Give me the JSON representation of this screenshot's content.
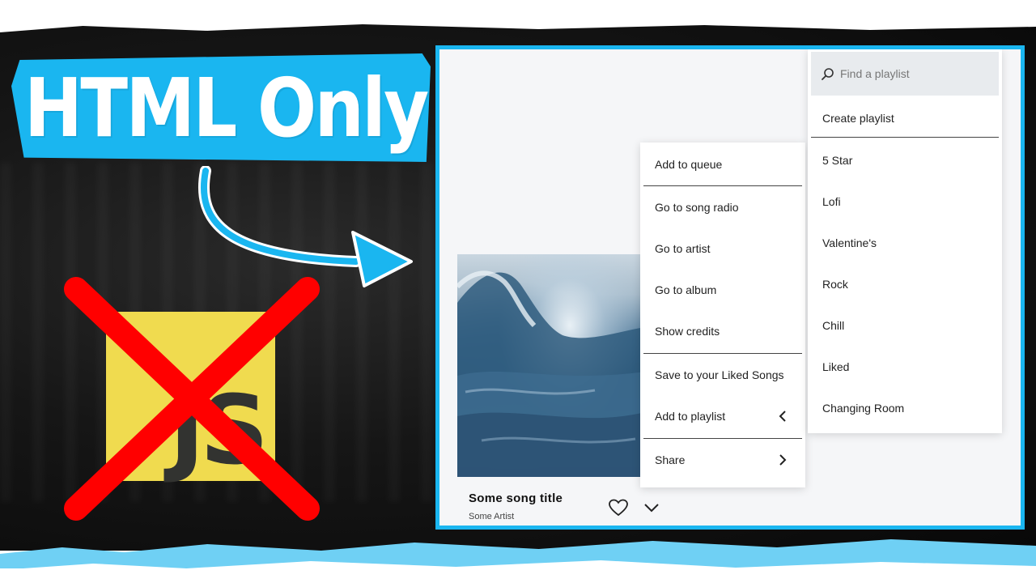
{
  "headline": {
    "text": "HTML Only"
  },
  "js_logo": {
    "text": "JS"
  },
  "song": {
    "title": "Some song title",
    "artist": "Some Artist"
  },
  "context_menu": {
    "items": [
      {
        "label": "Add to queue"
      },
      {
        "label": "Go to song radio"
      },
      {
        "label": "Go to artist"
      },
      {
        "label": "Go to album"
      },
      {
        "label": "Show credits"
      },
      {
        "label": "Save to your Liked Songs"
      },
      {
        "label": "Add to playlist",
        "icon": "chevron-left-icon"
      },
      {
        "label": "Share",
        "icon": "chevron-right-icon"
      }
    ]
  },
  "playlist_menu": {
    "search_placeholder": "Find a playlist",
    "create_label": "Create playlist",
    "playlists": [
      "5 Star",
      "Lofi",
      "Valentine's",
      "Rock",
      "Chill",
      "Liked",
      "Changing Room"
    ]
  },
  "colors": {
    "accent": "#1ab6f0",
    "js_yellow": "#f0db4f",
    "cross_red": "#ff0000"
  }
}
